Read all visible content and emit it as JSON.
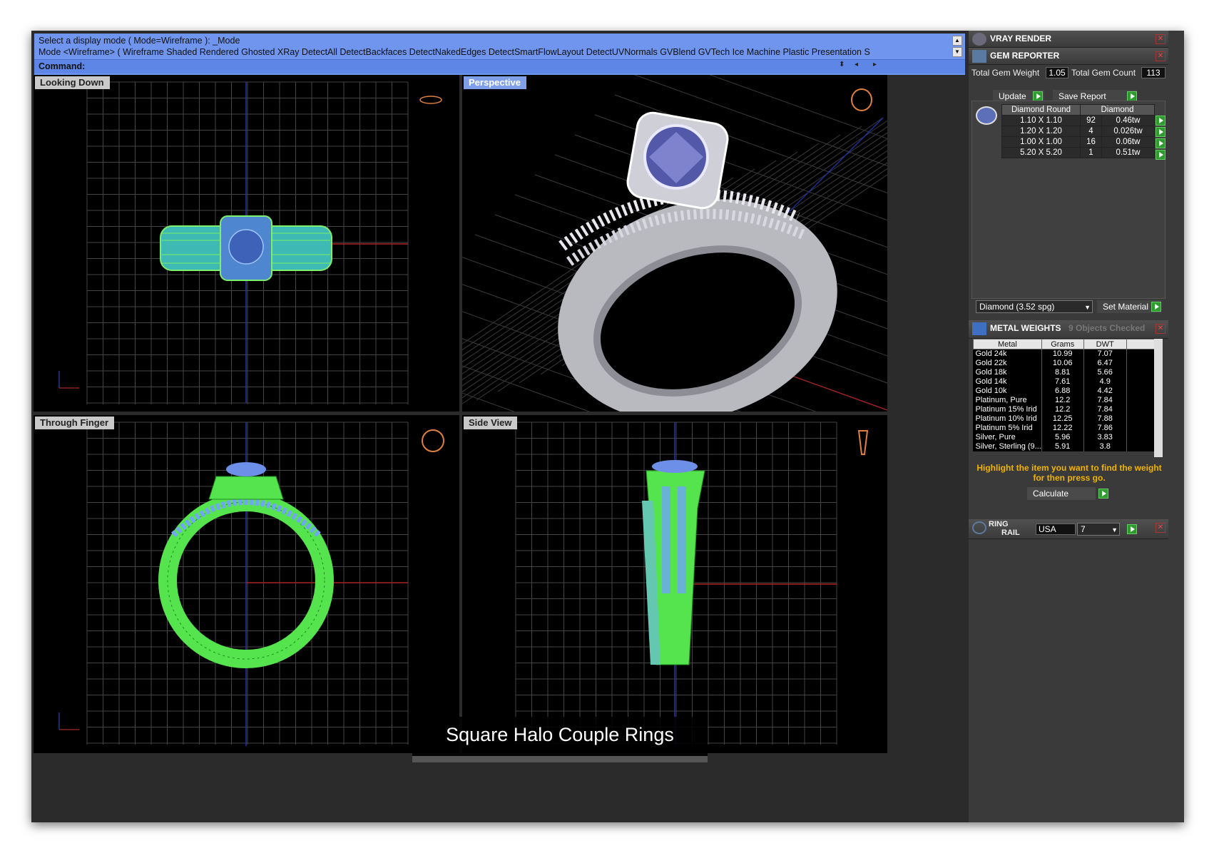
{
  "command": {
    "line1": "Select a display mode ( Mode=Wireframe ): _Mode",
    "line2": "Mode <Wireframe> ( Wireframe  Shaded  Rendered  Ghosted  XRay  DetectAll  DetectBackfaces  DetectNakedEdges  DetectSmartFlowLayout  DetectUVNormals  GVBlend  GVTech  Ice  Machine  Plastic  Presentation  S",
    "prompt_label": "Command:",
    "prompt_value": ""
  },
  "viewports": {
    "top_left": "Looking Down",
    "top_right": "Perspective",
    "bottom_left": "Through Finger",
    "bottom_right": "Side View"
  },
  "panel": {
    "vray": {
      "title": "VRAY RENDER"
    },
    "gem": {
      "title": "GEM REPORTER",
      "total_weight_label": "Total Gem Weight",
      "total_weight_value": "1.05",
      "total_count_label": "Total Gem Count",
      "total_count_value": "113",
      "update_label": "Update",
      "save_label": "Save Report",
      "col_shape": "Diamond Round",
      "col_material": "Diamond",
      "rows": [
        {
          "size": "1.10 X 1.10",
          "count": "92",
          "weight": "0.46tw"
        },
        {
          "size": "1.20 X 1.20",
          "count": "4",
          "weight": "0.026tw"
        },
        {
          "size": "1.00 X 1.00",
          "count": "16",
          "weight": "0.06tw"
        },
        {
          "size": "5.20 X 5.20",
          "count": "1",
          "weight": "0.51tw"
        }
      ],
      "material_select": "Diamond    (3.52 spg)",
      "set_material_label": "Set Material"
    },
    "metal": {
      "title": "METAL WEIGHTS",
      "checked": "9 Objects Checked",
      "col_metal": "Metal",
      "col_grams": "Grams",
      "col_dwt": "DWT",
      "rows": [
        {
          "metal": "Gold 24k",
          "grams": "10.99",
          "dwt": "7.07"
        },
        {
          "metal": "Gold 22k",
          "grams": "10.06",
          "dwt": "6.47"
        },
        {
          "metal": "Gold 18k",
          "grams": "8.81",
          "dwt": "5.66"
        },
        {
          "metal": "Gold 14k",
          "grams": "7.61",
          "dwt": "4.9"
        },
        {
          "metal": "Gold 10k",
          "grams": "6.88",
          "dwt": "4.42"
        },
        {
          "metal": "Platinum, Pure",
          "grams": "12.2",
          "dwt": "7.84"
        },
        {
          "metal": "Platinum 15% Irid",
          "grams": "12.2",
          "dwt": "7.84"
        },
        {
          "metal": "Platinum 10% Irid",
          "grams": "12.25",
          "dwt": "7.88"
        },
        {
          "metal": "Platinum 5% Irid",
          "grams": "12.22",
          "dwt": "7.86"
        },
        {
          "metal": "Silver, Pure",
          "grams": "5.96",
          "dwt": "3.83"
        },
        {
          "metal": "Silver, Sterling (9...",
          "grams": "5.91",
          "dwt": "3.8"
        }
      ],
      "hint": "Highlight the item you want to find the weight for then press go.",
      "calculate_label": "Calculate"
    },
    "ringrail": {
      "title_a": "RING",
      "title_b": "RAIL",
      "region": "USA",
      "size": "7"
    }
  },
  "caption": "Square Halo Couple Rings"
}
